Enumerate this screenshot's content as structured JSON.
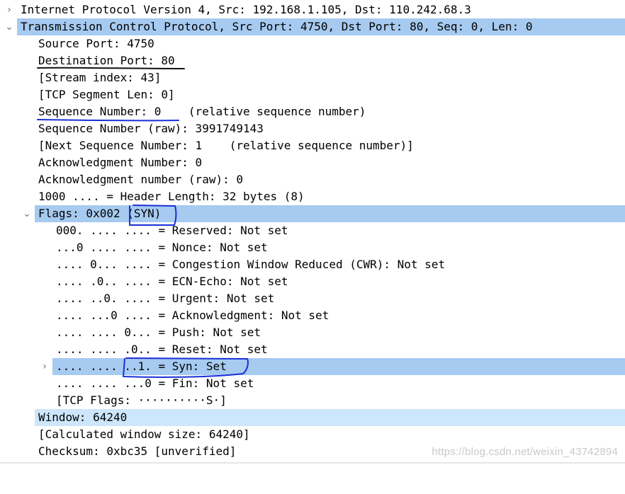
{
  "rows": [
    {
      "text": "Internet Protocol Version 4, Src: 192.168.1.105, Dst: 110.242.68.3",
      "toggle": "collapsed"
    },
    {
      "text": "Transmission Control Protocol, Src Port: 4750, Dst Port: 80, Seq: 0, Len: 0",
      "toggle": "expanded"
    },
    {
      "text": "Source Port: 4750"
    },
    {
      "text": "Destination Port: 80"
    },
    {
      "text": "[Stream index: 43]"
    },
    {
      "text": "[TCP Segment Len: 0]"
    },
    {
      "text": "Sequence Number: 0    (relative sequence number)"
    },
    {
      "text": "Sequence Number (raw): 3991749143"
    },
    {
      "text": "[Next Sequence Number: 1    (relative sequence number)]"
    },
    {
      "text": "Acknowledgment Number: 0"
    },
    {
      "text": "Acknowledgment number (raw): 0"
    },
    {
      "text": "1000 .... = Header Length: 32 bytes (8)"
    },
    {
      "text": "Flags: 0x002 (SYN)",
      "toggle": "expanded"
    },
    {
      "text": "000. .... .... = Reserved: Not set"
    },
    {
      "text": "...0 .... .... = Nonce: Not set"
    },
    {
      "text": ".... 0... .... = Congestion Window Reduced (CWR): Not set"
    },
    {
      "text": ".... .0.. .... = ECN-Echo: Not set"
    },
    {
      "text": ".... ..0. .... = Urgent: Not set"
    },
    {
      "text": ".... ...0 .... = Acknowledgment: Not set"
    },
    {
      "text": ".... .... 0... = Push: Not set"
    },
    {
      "text": ".... .... .0.. = Reset: Not set"
    },
    {
      "text": ".... .... ..1. = Syn: Set",
      "toggle": "collapsed"
    },
    {
      "text": ".... .... ...0 = Fin: Not set"
    },
    {
      "text": "[TCP Flags: ··········S·]"
    },
    {
      "text": "Window: 64240"
    },
    {
      "text": "[Calculated window size: 64240]"
    },
    {
      "text": "Checksum: 0xbc35 [unverified]"
    }
  ],
  "watermark": "https://blog.csdn.net/weixin_43742894",
  "colors": {
    "selection": "#a6caf0",
    "selection_light": "#cde6fb",
    "ink_black": "#111111",
    "ink_blue": "#1a2fd6"
  },
  "icons": {
    "collapsed": "chevron-right-icon",
    "expanded": "chevron-down-icon"
  }
}
